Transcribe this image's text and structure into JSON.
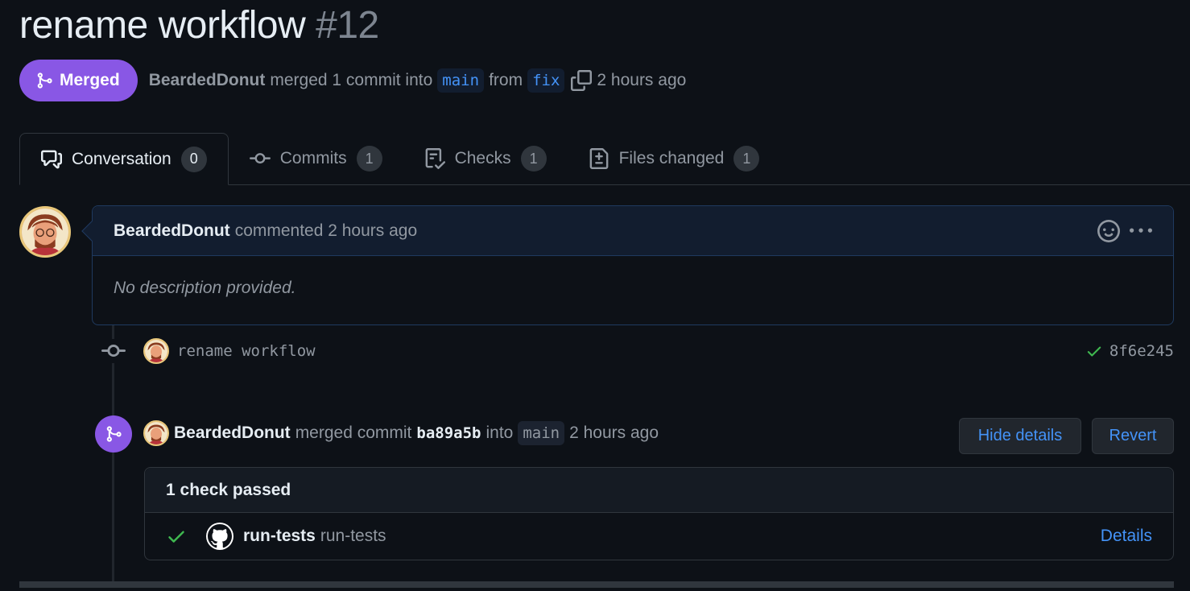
{
  "pr": {
    "title": "rename workflow",
    "number": "#12",
    "state_label": "Merged",
    "author": "BeardedDonut",
    "merge_text": "merged 1 commit into",
    "base_branch": "main",
    "from_text": "from",
    "head_branch": "fix",
    "time": "2 hours ago"
  },
  "tabs": [
    {
      "label": "Conversation",
      "count": "0"
    },
    {
      "label": "Commits",
      "count": "1"
    },
    {
      "label": "Checks",
      "count": "1"
    },
    {
      "label": "Files changed",
      "count": "1"
    }
  ],
  "comment": {
    "author": "BeardedDonut",
    "action": "commented 2 hours ago",
    "body": "No description provided."
  },
  "commit": {
    "message": "rename workflow",
    "sha": "8f6e245"
  },
  "merge_event": {
    "author": "BeardedDonut",
    "text1": "merged commit",
    "sha": "ba89a5b",
    "text2": "into",
    "branch": "main",
    "time": "2 hours ago",
    "hide_details_label": "Hide details",
    "revert_label": "Revert"
  },
  "checks": {
    "summary": "1 check passed",
    "items": [
      {
        "name": "run-tests",
        "description": "run-tests",
        "details_label": "Details"
      }
    ]
  },
  "colors": {
    "background": "#0d1117",
    "merged": "#8957e5",
    "link": "#4493f8",
    "success": "#3fb950"
  }
}
